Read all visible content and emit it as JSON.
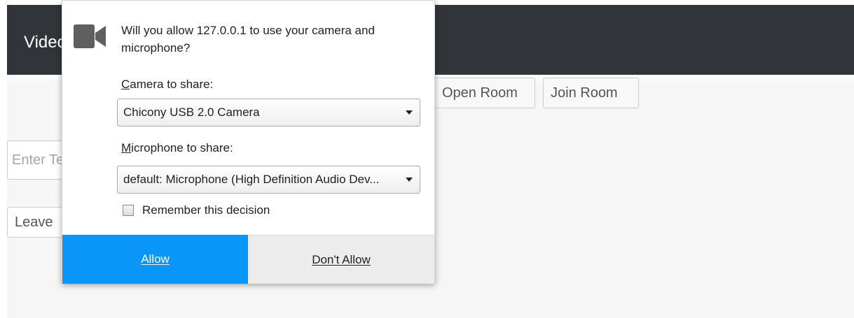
{
  "page": {
    "title": "Video",
    "room_input_placeholder": "Enter Text",
    "open_room_label": "Open Room",
    "join_room_label": "Join Room",
    "leave_label": "Leave"
  },
  "permission_dialog": {
    "icon": "video-camera-icon",
    "question": "Will you allow 127.0.0.1 to use your camera and microphone?",
    "camera_label": "Camera to share:",
    "camera_selected": "Chicony USB 2.0 Camera",
    "microphone_label": "Microphone to share:",
    "microphone_selected": "default: Microphone (High Definition Audio Dev...",
    "remember_label": "Remember this decision",
    "remember_checked": false,
    "allow_label": "Allow",
    "deny_label": "Don't Allow"
  },
  "colors": {
    "header_bg": "#313438",
    "allow_bg": "#0996f8",
    "deny_bg": "#ececec",
    "content_bg": "#f6f6f6"
  }
}
